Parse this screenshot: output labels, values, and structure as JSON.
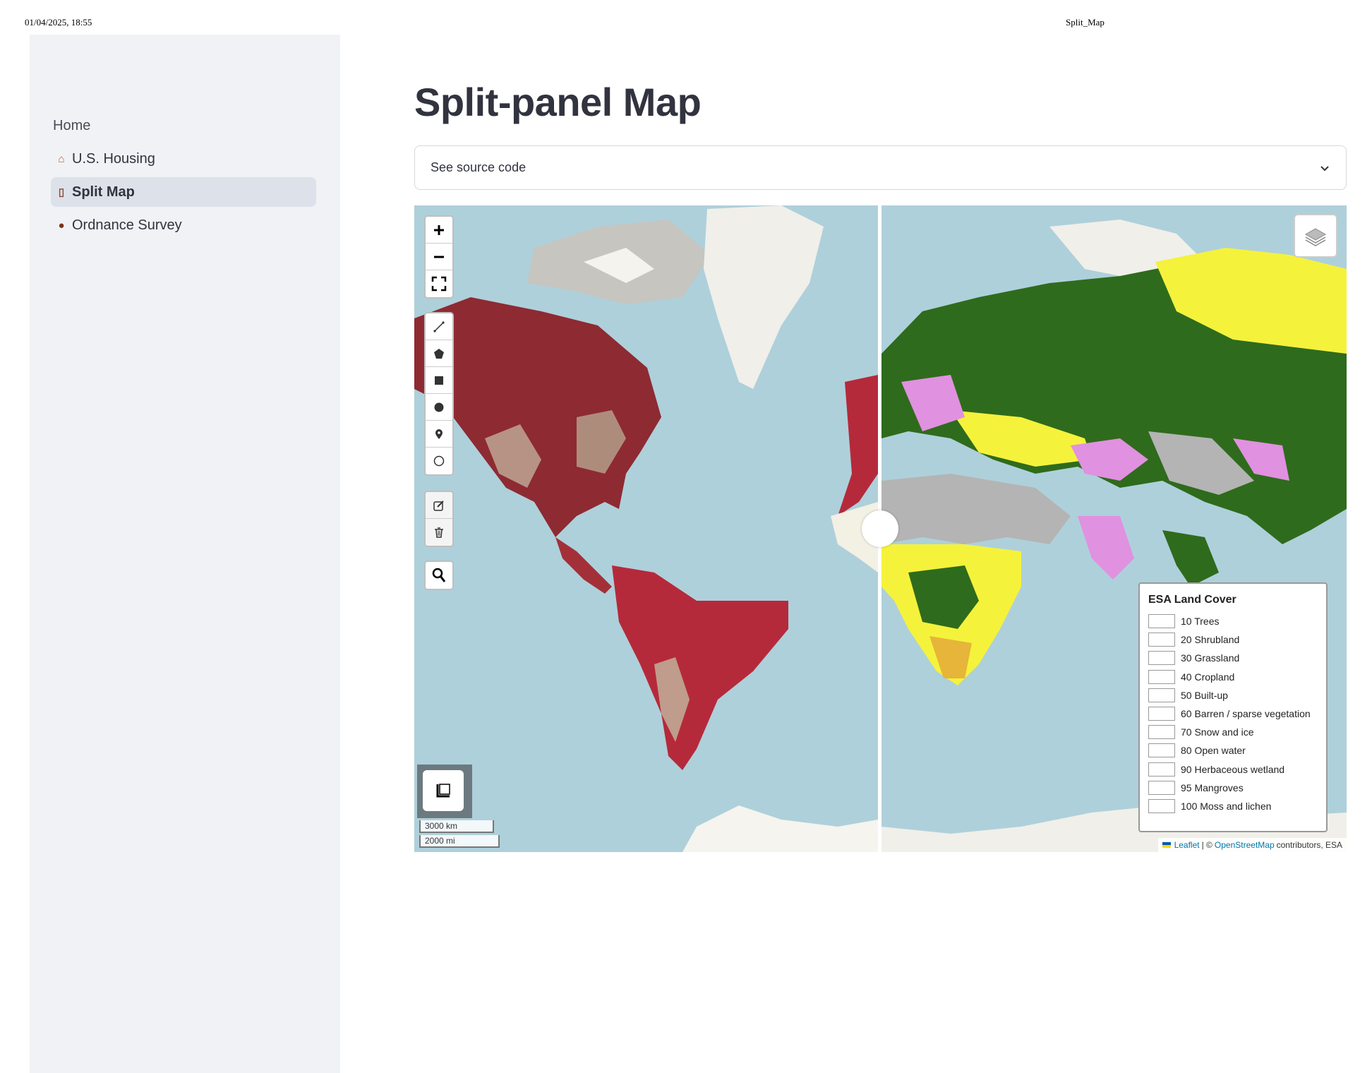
{
  "print_header": {
    "date": "01/04/2025, 18:55",
    "title": "Split_Map"
  },
  "sidebar": {
    "items": [
      {
        "label": "Home",
        "icon": ""
      },
      {
        "label": "U.S. Housing",
        "icon": "house-icon"
      },
      {
        "label": "Split Map",
        "icon": "door-icon",
        "active": true
      },
      {
        "label": "Ordnance Survey",
        "icon": "rock-icon"
      }
    ]
  },
  "main": {
    "title": "Split-panel Map",
    "expander": {
      "label": "See source code",
      "icon": "chevron-down-icon"
    }
  },
  "map": {
    "controls": {
      "zoom": [
        "zoom-in-icon",
        "zoom-out-icon",
        "fullscreen-icon"
      ],
      "draw": [
        "polyline-icon",
        "polygon-icon",
        "rectangle-icon",
        "circle-icon",
        "marker-icon",
        "circlemarker-icon"
      ],
      "edit": [
        "edit-icon",
        "trash-icon"
      ],
      "search": "search-icon",
      "layers": "layers-icon",
      "measure": "ruler-icon"
    },
    "scale": {
      "km": "3000 km",
      "mi": "2000 mi"
    },
    "legend": {
      "title": "ESA Land Cover",
      "items": [
        {
          "label": "10 Trees"
        },
        {
          "label": "20 Shrubland"
        },
        {
          "label": "30 Grassland"
        },
        {
          "label": "40 Cropland"
        },
        {
          "label": "50 Built-up"
        },
        {
          "label": "60 Barren / sparse vegetation"
        },
        {
          "label": "70 Snow and ice"
        },
        {
          "label": "80 Open water"
        },
        {
          "label": "90 Herbaceous wetland"
        },
        {
          "label": "95 Mangroves"
        },
        {
          "label": "100 Moss and lichen"
        }
      ]
    },
    "attribution": {
      "leaflet": "Leaflet",
      "sep": "| ©",
      "osm": "OpenStreetMap",
      "rest": "contributors, ESA"
    },
    "colors": {
      "ocean": "#a9cfd9",
      "satellite_red": "#9a2a34",
      "trees": "#2f6b1c",
      "grassland": "#f5f23c",
      "barren": "#b4b4b4",
      "cropland": "#e091e0",
      "snow": "#f0efe9"
    }
  }
}
